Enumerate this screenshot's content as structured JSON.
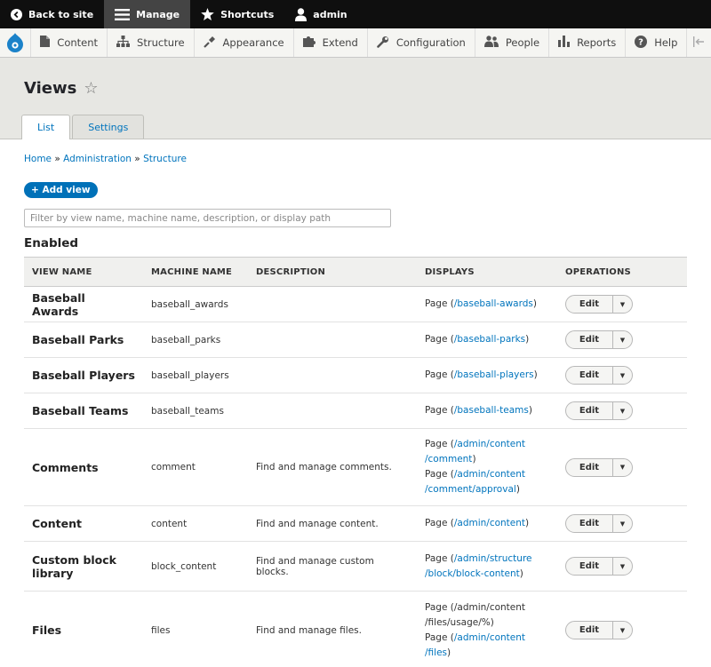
{
  "toolbar": {
    "back": "Back to site",
    "manage": "Manage",
    "shortcuts": "Shortcuts",
    "user": "admin"
  },
  "tray": {
    "items": [
      "Content",
      "Structure",
      "Appearance",
      "Extend",
      "Configuration",
      "People",
      "Reports",
      "Help"
    ]
  },
  "page": {
    "title": "Views",
    "tabs": [
      "List",
      "Settings"
    ]
  },
  "breadcrumb": [
    "Home",
    "Administration",
    "Structure"
  ],
  "add_view": "+ Add view",
  "filter": {
    "placeholder": "Filter by view name, machine name, description, or display path",
    "value": ""
  },
  "section": "Enabled",
  "table": {
    "headers": [
      "VIEW NAME",
      "MACHINE NAME",
      "DESCRIPTION",
      "DISPLAYS",
      "OPERATIONS"
    ],
    "edit_label": "Edit",
    "rows": [
      {
        "name": "Baseball Awards",
        "machine": "baseball_awards",
        "desc": "",
        "lines": [
          [
            [
              "t",
              "Page ("
            ],
            [
              "a",
              "/baseball-awards"
            ],
            [
              "t",
              ")"
            ]
          ]
        ]
      },
      {
        "name": "Baseball Parks",
        "machine": "baseball_parks",
        "desc": "",
        "lines": [
          [
            [
              "t",
              "Page ("
            ],
            [
              "a",
              "/baseball-parks"
            ],
            [
              "t",
              ")"
            ]
          ]
        ]
      },
      {
        "name": "Baseball Players",
        "machine": "baseball_players",
        "desc": "",
        "lines": [
          [
            [
              "t",
              "Page ("
            ],
            [
              "a",
              "/baseball-players"
            ],
            [
              "t",
              ")"
            ]
          ]
        ]
      },
      {
        "name": "Baseball Teams",
        "machine": "baseball_teams",
        "desc": "",
        "lines": [
          [
            [
              "t",
              "Page ("
            ],
            [
              "a",
              "/baseball-teams"
            ],
            [
              "t",
              ")"
            ]
          ]
        ]
      },
      {
        "name": "Comments",
        "machine": "comment",
        "desc": "Find and manage comments.",
        "lines": [
          [
            [
              "t",
              "Page ("
            ],
            [
              "a",
              "/admin/content"
            ]
          ],
          [
            [
              "a",
              "/comment"
            ],
            [
              "t",
              ")"
            ]
          ],
          [
            [
              "t",
              "Page ("
            ],
            [
              "a",
              "/admin/content"
            ]
          ],
          [
            [
              "a",
              "/comment/approval"
            ],
            [
              "t",
              ")"
            ]
          ]
        ]
      },
      {
        "name": "Content",
        "machine": "content",
        "desc": "Find and manage content.",
        "lines": [
          [
            [
              "t",
              "Page ("
            ],
            [
              "a",
              "/admin/content"
            ],
            [
              "t",
              ")"
            ]
          ]
        ]
      },
      {
        "name": "Custom block library",
        "machine": "block_content",
        "desc": "Find and manage custom blocks.",
        "lines": [
          [
            [
              "t",
              "Page ("
            ],
            [
              "a",
              "/admin/structure"
            ]
          ],
          [
            [
              "a",
              "/block/block-content"
            ],
            [
              "t",
              ")"
            ]
          ]
        ]
      },
      {
        "name": "Files",
        "machine": "files",
        "desc": "Find and manage files.",
        "lines": [
          [
            [
              "t",
              "Page (/admin/content"
            ]
          ],
          [
            [
              "t",
              "/files/usage/%)"
            ]
          ],
          [
            [
              "t",
              "Page ("
            ],
            [
              "a",
              "/admin/content"
            ]
          ],
          [
            [
              "a",
              "/files"
            ],
            [
              "t",
              ")"
            ]
          ]
        ]
      }
    ]
  }
}
